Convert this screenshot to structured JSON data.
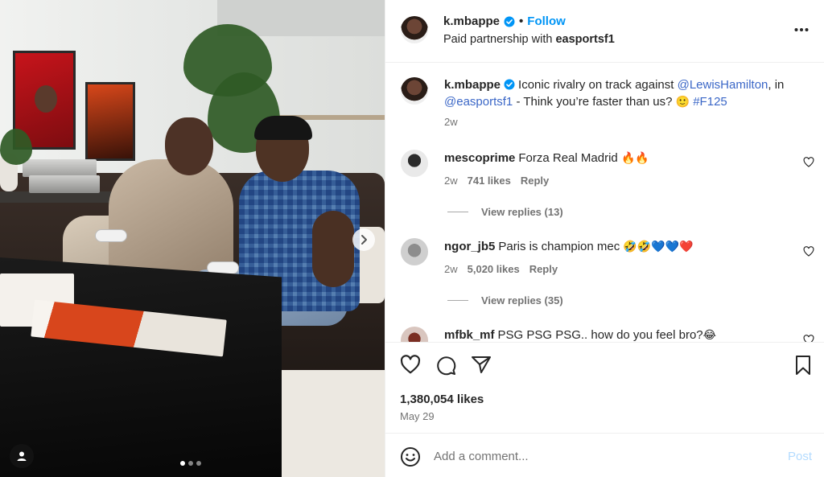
{
  "post": {
    "author": "k.mbappe",
    "follow_label": "Follow",
    "separator": "•",
    "partnership_prefix": "Paid partnership with ",
    "partner": "easportsf1"
  },
  "caption": {
    "username": "k.mbappe",
    "text_1": "Iconic rivalry on track against ",
    "mention_1": "@LewisHamilton",
    "text_2": ", in ",
    "mention_2": "@easportsf1",
    "text_3": " - Think you’re faster than us? ",
    "emoji": "🙂",
    "hashtag": "#F125",
    "time": "2w"
  },
  "comments": [
    {
      "username": "mescoprime",
      "text": "Forza Real Madrid",
      "emoji": "🔥🔥",
      "time": "2w",
      "likes": "741 likes",
      "reply": "Reply",
      "view_replies": "View replies (13)"
    },
    {
      "username": "ngor_jb5",
      "text": "Paris is champion mec",
      "emoji": "🤣🤣💙💙❤️",
      "time": "2w",
      "likes": "5,020 likes",
      "reply": "Reply",
      "view_replies": "View replies (35)"
    },
    {
      "username": "mfbk_mf",
      "text": "PSG PSG PSG.. how do you feel bro?",
      "emoji": "😂"
    }
  ],
  "stats": {
    "likes": "1,380,054 likes",
    "date": "May 29"
  },
  "composer": {
    "placeholder": "Add a comment...",
    "post_label": "Post"
  },
  "icons": {
    "more": "more-options-icon",
    "like": "heart-icon",
    "comment": "comment-icon",
    "share": "share-icon",
    "save": "bookmark-icon",
    "emoji": "emoji-icon",
    "next": "chevron-right-icon",
    "tags": "user-tag-icon",
    "verified": "verified-badge-icon"
  },
  "colors": {
    "accent": "#0095f6",
    "mention": "#3b67c7",
    "secondary_text": "#737373",
    "post_disabled": "#b3dbff"
  },
  "carousel": {
    "slides": 3,
    "active_slide": 1
  }
}
